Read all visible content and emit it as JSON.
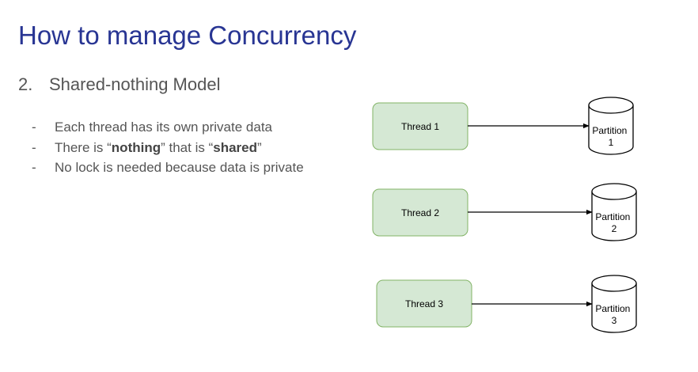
{
  "slide": {
    "title": "How to manage Concurrency",
    "subtitle_number": "2.",
    "subtitle_text": "Shared-nothing Model",
    "bullets": [
      {
        "marker": "-",
        "parts": [
          "Each thread has its own private data"
        ]
      },
      {
        "marker": "-",
        "parts": [
          "There is “",
          "nothing",
          "” that is “",
          "shared",
          "”"
        ]
      },
      {
        "marker": "-",
        "parts": [
          "No lock is needed because data is private"
        ]
      }
    ]
  },
  "diagram": {
    "colors": {
      "thread_fill": "#d5e8d4",
      "thread_stroke": "#82b366",
      "partition_fill": "#ffffff",
      "partition_stroke": "#000000",
      "edge": "#000000"
    },
    "threads": [
      {
        "label": "Thread 1"
      },
      {
        "label": "Thread 2"
      },
      {
        "label": "Thread 3"
      }
    ],
    "partitions": [
      {
        "line1": "Partition",
        "line2": "1"
      },
      {
        "line1": "Partition",
        "line2": "2"
      },
      {
        "line1": "Partition",
        "line2": "3"
      }
    ]
  }
}
